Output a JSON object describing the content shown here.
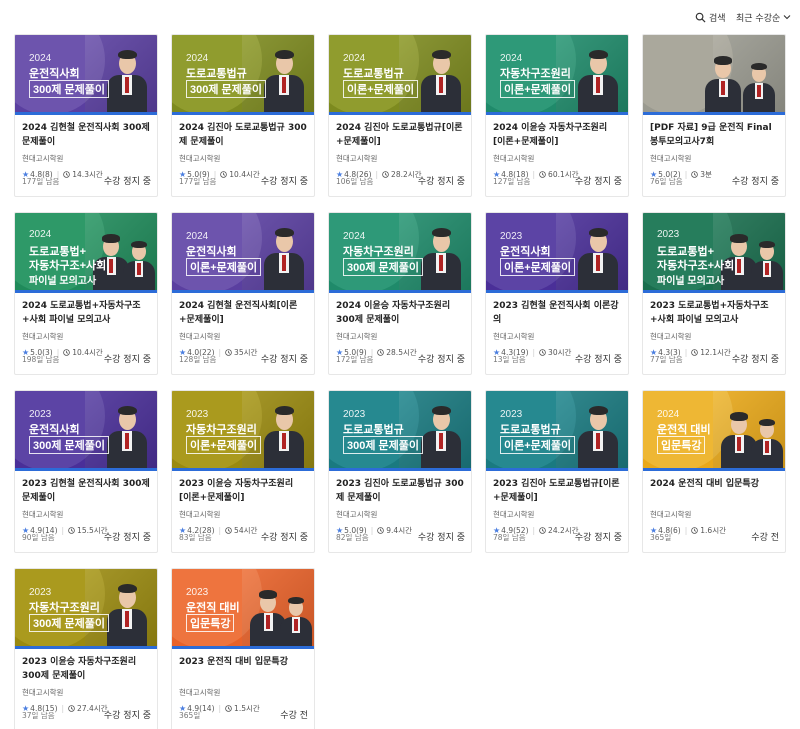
{
  "header": {
    "search_label": "검색",
    "sort_label": "최근 수강순"
  },
  "courses": [
    {
      "title": "2024 김현철 운전직사회 300제 문제풀이",
      "institution": "현대고시학원",
      "rating": "4.8",
      "reviews": "(8)",
      "duration": "14.3시간",
      "remaining": "177일 남음",
      "status": "수강 정지 중",
      "thumb": {
        "year": "2024",
        "line1": "운전직사회",
        "line2": "300제 문제풀이",
        "line3": "",
        "bg": "#5a3fa0",
        "accent": "#7d66b8",
        "persons": 1
      }
    },
    {
      "title": "2024 김진아 도로교통법규 300제 문제풀이",
      "institution": "현대고시학원",
      "rating": "5.0",
      "reviews": "(9)",
      "duration": "10.4시간",
      "remaining": "177일 남음",
      "status": "수강 정지 중",
      "thumb": {
        "year": "2024",
        "line1": "도로교통법규",
        "line2": "300제 문제풀이",
        "line3": "",
        "bg": "#7d8a1f",
        "accent": "#a0ab3a",
        "persons": 1
      }
    },
    {
      "title": "2024 김진아 도로교통법규[이론+문제풀이]",
      "institution": "현대고시학원",
      "rating": "4.8",
      "reviews": "(26)",
      "duration": "28.2시간",
      "remaining": "106일 남음",
      "status": "수강 정지 중",
      "thumb": {
        "year": "2024",
        "line1": "도로교통법규",
        "line2": "이론+문제풀이",
        "line3": "",
        "bg": "#7d8a1f",
        "accent": "#a0ab3a",
        "persons": 1
      }
    },
    {
      "title": "2024 이윤승 자동차구조원리 [이론+문제풀이]",
      "institution": "현대고시학원",
      "rating": "4.8",
      "reviews": "(18)",
      "duration": "60.1시간",
      "remaining": "127일 남음",
      "status": "수강 정지 중",
      "thumb": {
        "year": "2024",
        "line1": "자동차구조원리",
        "line2": "이론+문제풀이",
        "line3": "",
        "bg": "#1f8a6a",
        "accent": "#3aa583",
        "persons": 1
      }
    },
    {
      "title": "[PDF 자료] 9급 운전직 Final 봉투모의고사7회",
      "institution": "현대고시학원",
      "rating": "5.0",
      "reviews": "(2)",
      "duration": "3분",
      "remaining": "76일 남음",
      "status": "수강 정지 중",
      "thumb": {
        "year": "",
        "line1": "",
        "line2": "",
        "line3": "",
        "bg": "#9a9a90",
        "accent": "#b8b4a6",
        "persons": 2
      }
    },
    {
      "title": "2024 도로교통법+자동차구조+사회 파이널 모의고사",
      "institution": "현대고시학원",
      "rating": "5.0",
      "reviews": "(3)",
      "duration": "10.4시간",
      "remaining": "198일 남음",
      "status": "수강 정지 중",
      "thumb": {
        "year": "2024",
        "line1": "도로교통법+",
        "line2": "자동차구조+사회",
        "line3": "파이널 모의고사",
        "bg": "#1f8a5a",
        "accent": "#3aa574",
        "persons": 2
      }
    },
    {
      "title": "2024 김현철 운전직사회[이론+문제풀이]",
      "institution": "현대고시학원",
      "rating": "4.0",
      "reviews": "(22)",
      "duration": "35시간",
      "remaining": "128일 남음",
      "status": "수강 정지 중",
      "thumb": {
        "year": "2024",
        "line1": "운전직사회",
        "line2": "이론+문제풀이",
        "line3": "",
        "bg": "#5a3fa0",
        "accent": "#7d66b8",
        "persons": 1
      }
    },
    {
      "title": "2024 이윤승 자동차구조원리 300제 문제풀이",
      "institution": "현대고시학원",
      "rating": "5.0",
      "reviews": "(9)",
      "duration": "28.5시간",
      "remaining": "172일 남음",
      "status": "수강 정지 중",
      "thumb": {
        "year": "2024",
        "line1": "자동차구조원리",
        "line2": "300제 문제풀이",
        "line3": "",
        "bg": "#1f8a6a",
        "accent": "#3aa583",
        "persons": 1
      }
    },
    {
      "title": "2023 김현철 운전직사회 이론강의",
      "institution": "현대고시학원",
      "rating": "4.3",
      "reviews": "(19)",
      "duration": "30시간",
      "remaining": "13일 남음",
      "status": "수강 정지 중",
      "thumb": {
        "year": "2023",
        "line1": "운전직사회",
        "line2": "이론+문제풀이",
        "line3": "",
        "bg": "#4a2f98",
        "accent": "#6c55b0",
        "persons": 1
      }
    },
    {
      "title": "2023 도로교통법+자동차구조+사회 파이널 모의고사",
      "institution": "현대고시학원",
      "rating": "4.3",
      "reviews": "(3)",
      "duration": "12.1시간",
      "remaining": "77일 남음",
      "status": "수강 정지 중",
      "thumb": {
        "year": "2023",
        "line1": "도로교통법+",
        "line2": "자동차구조+사회",
        "line3": "파이널 모의고사",
        "bg": "#1a6e4e",
        "accent": "#318a68",
        "persons": 2
      }
    },
    {
      "title": "2023 김현철 운전직사회 300제 문제풀이",
      "institution": "현대고시학원",
      "rating": "4.9",
      "reviews": "(14)",
      "duration": "15.5시간",
      "remaining": "90일 남음",
      "status": "수강 정지 중",
      "thumb": {
        "year": "2023",
        "line1": "운전직사회",
        "line2": "300제 문제풀이",
        "line3": "",
        "bg": "#4a2f98",
        "accent": "#6c55b0",
        "persons": 1
      }
    },
    {
      "title": "2023 이윤승 자동차구조원리 [이론+문제풀이]",
      "institution": "현대고시학원",
      "rating": "4.2",
      "reviews": "(28)",
      "duration": "54시간",
      "remaining": "83일 남음",
      "status": "수강 정지 중",
      "thumb": {
        "year": "2023",
        "line1": "자동차구조원리",
        "line2": "이론+문제풀이",
        "line3": "",
        "bg": "#9a8a10",
        "accent": "#b8a82a",
        "persons": 1
      }
    },
    {
      "title": "2023 김진아 도로교통법규 300제 문제풀이",
      "institution": "현대고시학원",
      "rating": "5.0",
      "reviews": "(9)",
      "duration": "9.4시간",
      "remaining": "82일 남음",
      "status": "수강 정지 중",
      "thumb": {
        "year": "2023",
        "line1": "도로교통법규",
        "line2": "300제 문제풀이",
        "line3": "",
        "bg": "#1a7a80",
        "accent": "#32969c",
        "persons": 1
      }
    },
    {
      "title": "2023 김진아 도로교통법규[이론+문제풀이]",
      "institution": "현대고시학원",
      "rating": "4.9",
      "reviews": "(52)",
      "duration": "24.2시간",
      "remaining": "78일 남음",
      "status": "수강 정지 중",
      "thumb": {
        "year": "2023",
        "line1": "도로교통법규",
        "line2": "이론+문제풀이",
        "line3": "",
        "bg": "#1a7a80",
        "accent": "#32969c",
        "persons": 1
      }
    },
    {
      "title": "2024 운전직 대비 입문특강",
      "institution": "현대고시학원",
      "rating": "4.8",
      "reviews": "(6)",
      "duration": "1.6시간",
      "remaining": "365일",
      "status": "수강 전",
      "thumb": {
        "year": "2024",
        "line1": "운전직 대비",
        "line2": "입문특강",
        "line3": "",
        "bg": "#e8a81a",
        "accent": "#f3c34a",
        "persons": 2
      }
    },
    {
      "title": "2023 이윤승 자동차구조원리 300제 문제풀이",
      "institution": "현대고시학원",
      "rating": "4.8",
      "reviews": "(15)",
      "duration": "27.4시간",
      "remaining": "37일 남음",
      "status": "수강 정지 중",
      "thumb": {
        "year": "2023",
        "line1": "자동차구조원리",
        "line2": "300제 문제풀이",
        "line3": "",
        "bg": "#9a8a10",
        "accent": "#b8a82a",
        "persons": 1
      }
    },
    {
      "title": "2023 운전직 대비 입문특강",
      "institution": "현대고시학원",
      "rating": "4.9",
      "reviews": "(14)",
      "duration": "1.5시간",
      "remaining": "365일",
      "status": "수강 전",
      "thumb": {
        "year": "2023",
        "line1": "운전직 대비",
        "line2": "입문특강",
        "line3": "",
        "bg": "#e8622a",
        "accent": "#f2844e",
        "persons": 2
      }
    }
  ]
}
